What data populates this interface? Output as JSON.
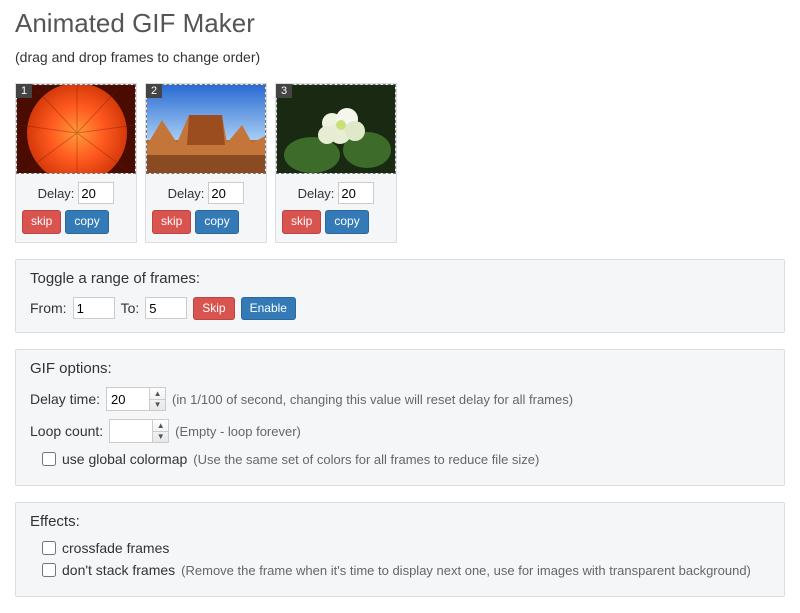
{
  "title": "Animated GIF Maker",
  "subtitle": "(drag and drop frames to change order)",
  "frame_delay_label": "Delay:",
  "frame_skip_label": "skip",
  "frame_copy_label": "copy",
  "frames": [
    {
      "index": "1",
      "delay": "20"
    },
    {
      "index": "2",
      "delay": "20"
    },
    {
      "index": "3",
      "delay": "20"
    }
  ],
  "toggle": {
    "title": "Toggle a range of frames:",
    "from_label": "From:",
    "from_value": "1",
    "to_label": "To:",
    "to_value": "5",
    "skip_label": "Skip",
    "enable_label": "Enable"
  },
  "gif_options": {
    "title": "GIF options:",
    "delay_label": "Delay time:",
    "delay_value": "20",
    "delay_hint": "(in 1/100 of second, changing this value will reset delay for all frames)",
    "loop_label": "Loop count:",
    "loop_value": "",
    "loop_hint": "(Empty - loop forever)",
    "global_colormap_label": "use global colormap",
    "global_colormap_hint": "(Use the same set of colors for all frames to reduce file size)"
  },
  "effects": {
    "title": "Effects:",
    "crossfade_label": "crossfade frames",
    "dont_stack_label": "don't stack frames",
    "dont_stack_hint": "(Remove the frame when it's time to display next one, use for images with transparent background)"
  }
}
